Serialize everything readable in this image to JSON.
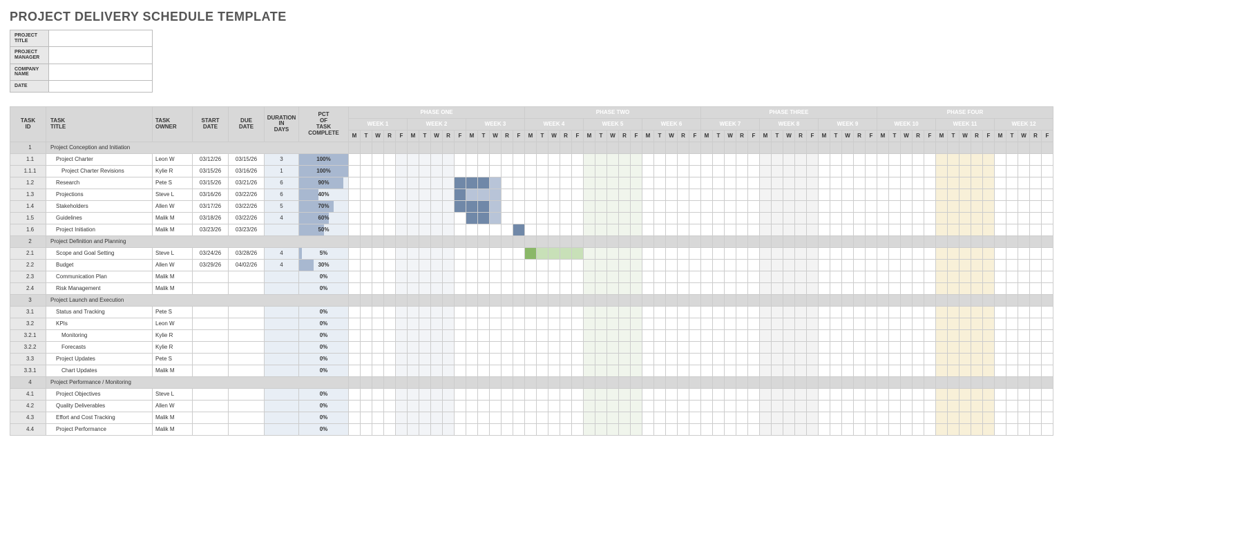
{
  "title": "PROJECT DELIVERY SCHEDULE TEMPLATE",
  "meta": {
    "labels": [
      "PROJECT TITLE",
      "PROJECT MANAGER",
      "COMPANY NAME",
      "DATE"
    ],
    "values": [
      "",
      "",
      "",
      ""
    ]
  },
  "columns": {
    "task_id": "TASK ID",
    "task_title": "TASK TITLE",
    "task_owner": "TASK OWNER",
    "start_date": "START DATE",
    "due_date": "DUE DATE",
    "duration": "DURATION IN DAYS",
    "pct": "PCT OF TASK COMPLETE"
  },
  "phases": [
    "PHASE ONE",
    "PHASE TWO",
    "PHASE THREE",
    "PHASE FOUR"
  ],
  "weeks": [
    "WEEK 1",
    "WEEK 2",
    "WEEK 3",
    "WEEK 4",
    "WEEK 5",
    "WEEK 6",
    "WEEK 7",
    "WEEK 8",
    "WEEK 9",
    "WEEK 10",
    "WEEK 11",
    "WEEK 12"
  ],
  "days": [
    "M",
    "T",
    "W",
    "R",
    "F"
  ],
  "rows": [
    {
      "id": "1",
      "title": "Project Conception and Initiation",
      "section": true
    },
    {
      "id": "1.1",
      "title": "Project Charter",
      "owner": "Leon W",
      "start": "03/12/26",
      "due": "03/15/26",
      "dur": "3",
      "pct": 100,
      "indent": 1,
      "bar": {
        "from": 5,
        "to": 7,
        "style": "g1"
      }
    },
    {
      "id": "1.1.1",
      "title": "Project Charter Revisions",
      "owner": "Kylie R",
      "start": "03/15/26",
      "due": "03/16/26",
      "dur": "1",
      "pct": 100,
      "indent": 2,
      "bar": {
        "from": 8,
        "to": 8,
        "style": "g1"
      },
      "shade": [
        {
          "from": 5,
          "to": 7,
          "style": "g1l"
        }
      ]
    },
    {
      "id": "1.2",
      "title": "Research",
      "owner": "Pete S",
      "start": "03/15/26",
      "due": "03/21/26",
      "dur": "6",
      "pct": 90,
      "indent": 1,
      "bar": {
        "from": 8,
        "to": 12,
        "style": "g1"
      },
      "shade": [
        {
          "from": 13,
          "to": 13,
          "style": "g1l"
        }
      ]
    },
    {
      "id": "1.3",
      "title": "Projections",
      "owner": "Steve L",
      "start": "03/16/26",
      "due": "03/22/26",
      "dur": "6",
      "pct": 40,
      "indent": 1,
      "bar": {
        "from": 9,
        "to": 10,
        "style": "g1"
      },
      "shade": [
        {
          "from": 11,
          "to": 13,
          "style": "g1l"
        }
      ]
    },
    {
      "id": "1.4",
      "title": "Stakeholders",
      "owner": "Allen W",
      "start": "03/17/26",
      "due": "03/22/26",
      "dur": "5",
      "pct": 70,
      "indent": 1,
      "bar": {
        "from": 10,
        "to": 12,
        "style": "g1"
      },
      "shade": [
        {
          "from": 13,
          "to": 13,
          "style": "g1l"
        }
      ]
    },
    {
      "id": "1.5",
      "title": "Guidelines",
      "owner": "Malik M",
      "start": "03/18/26",
      "due": "03/22/26",
      "dur": "4",
      "pct": 60,
      "indent": 1,
      "bar": {
        "from": 11,
        "to": 12,
        "style": "g1"
      },
      "shade": [
        {
          "from": 13,
          "to": 13,
          "style": "g1l"
        }
      ]
    },
    {
      "id": "1.6",
      "title": "Project Initiation",
      "owner": "Malik M",
      "start": "03/23/26",
      "due": "03/23/26",
      "dur": "",
      "pct": 50,
      "indent": 1,
      "bar": {
        "from": 15,
        "to": 15,
        "style": "g1"
      }
    },
    {
      "id": "2",
      "title": "Project Definition and Planning",
      "section": true
    },
    {
      "id": "2.1",
      "title": "Scope and Goal Setting",
      "owner": "Steve L",
      "start": "03/24/26",
      "due": "03/28/26",
      "dur": "4",
      "pct": 5,
      "indent": 1,
      "bar": {
        "from": 16,
        "to": 16,
        "style": "g2"
      },
      "shade": [
        {
          "from": 17,
          "to": 20,
          "style": "g2l"
        }
      ]
    },
    {
      "id": "2.2",
      "title": "Budget",
      "owner": "Allen W",
      "start": "03/29/26",
      "due": "04/02/26",
      "dur": "4",
      "pct": 30,
      "indent": 1,
      "bar": {
        "from": 21,
        "to": 21,
        "style": "g2"
      },
      "shade": [
        {
          "from": 22,
          "to": 25,
          "style": "g2l"
        }
      ]
    },
    {
      "id": "2.3",
      "title": "Communication Plan",
      "owner": "Malik M",
      "start": "",
      "due": "",
      "dur": "",
      "pct": 0,
      "indent": 1
    },
    {
      "id": "2.4",
      "title": "Risk Management",
      "owner": "Malik M",
      "start": "",
      "due": "",
      "dur": "",
      "pct": 0,
      "indent": 1
    },
    {
      "id": "3",
      "title": "Project Launch and Execution",
      "section": true
    },
    {
      "id": "3.1",
      "title": "Status and Tracking",
      "owner": "Pete S",
      "start": "",
      "due": "",
      "dur": "",
      "pct": 0,
      "indent": 1
    },
    {
      "id": "3.2",
      "title": "KPIs",
      "owner": "Leon W",
      "start": "",
      "due": "",
      "dur": "",
      "pct": 0,
      "indent": 1
    },
    {
      "id": "3.2.1",
      "title": "Monitoring",
      "owner": "Kylie R",
      "start": "",
      "due": "",
      "dur": "",
      "pct": 0,
      "indent": 2
    },
    {
      "id": "3.2.2",
      "title": "Forecasts",
      "owner": "Kylie R",
      "start": "",
      "due": "",
      "dur": "",
      "pct": 0,
      "indent": 2
    },
    {
      "id": "3.3",
      "title": "Project Updates",
      "owner": "Pete S",
      "start": "",
      "due": "",
      "dur": "",
      "pct": 0,
      "indent": 1
    },
    {
      "id": "3.3.1",
      "title": "Chart Updates",
      "owner": "Malik M",
      "start": "",
      "due": "",
      "dur": "",
      "pct": 0,
      "indent": 2
    },
    {
      "id": "4",
      "title": "Project Performance / Monitoring",
      "section": true
    },
    {
      "id": "4.1",
      "title": "Project Objectives",
      "owner": "Steve L",
      "start": "",
      "due": "",
      "dur": "",
      "pct": 0,
      "indent": 1
    },
    {
      "id": "4.2",
      "title": "Quality Deliverables",
      "owner": "Allen W",
      "start": "",
      "due": "",
      "dur": "",
      "pct": 0,
      "indent": 1
    },
    {
      "id": "4.3",
      "title": "Effort and Cost Tracking",
      "owner": "Malik M",
      "start": "",
      "due": "",
      "dur": "",
      "pct": 0,
      "indent": 1
    },
    {
      "id": "4.4",
      "title": "Project Performance",
      "owner": "Malik M",
      "start": "",
      "due": "",
      "dur": "",
      "pct": 0,
      "indent": 1
    }
  ],
  "shaded_columns": {
    "s1": [
      5,
      6,
      7,
      8,
      9
    ],
    "s2": [
      21,
      22,
      23,
      24,
      25
    ],
    "s3": [
      36,
      37,
      38,
      39,
      40
    ],
    "s4": [
      51,
      52,
      53,
      54,
      55
    ]
  }
}
